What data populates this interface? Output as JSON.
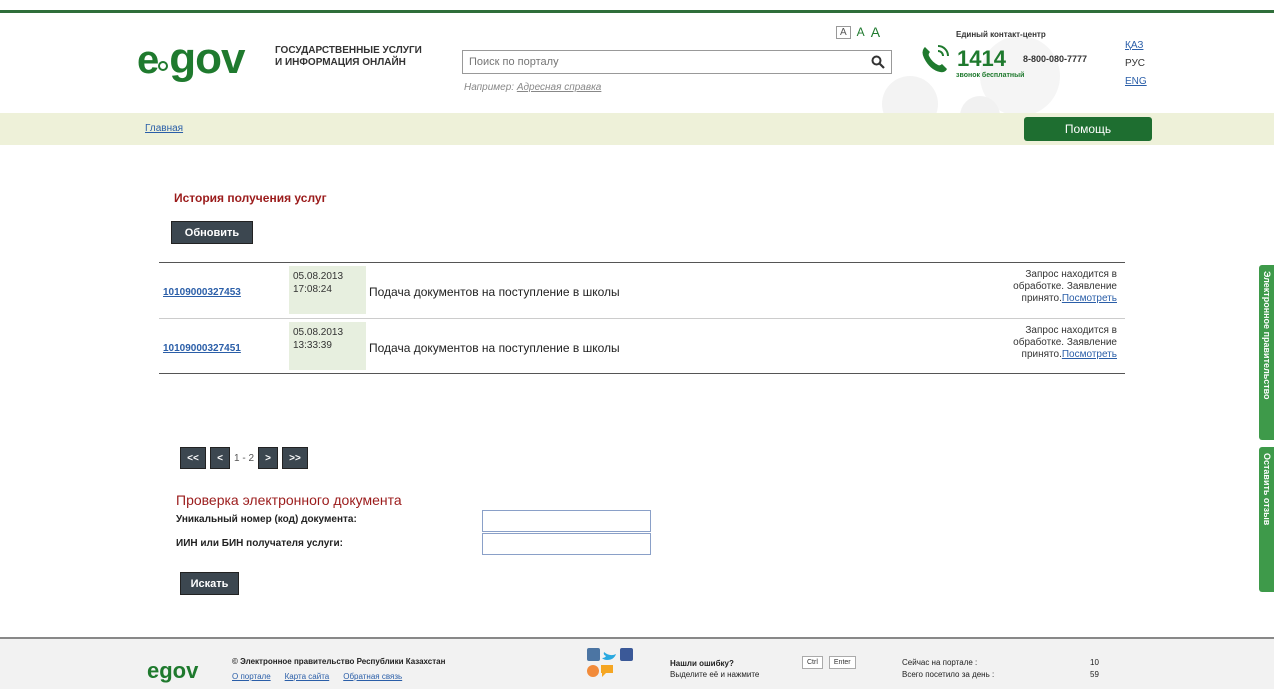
{
  "header": {
    "logo_text": "egov",
    "tagline_line1": "Государственные услуги",
    "tagline_line2": "и информация онлайн",
    "search_placeholder": "Поиск по порталу",
    "search_example_prefix": "Например:",
    "search_example_link": "Адресная справка",
    "font_size_labels": [
      "A",
      "A",
      "A"
    ],
    "contact_label": "Единый контакт-центр",
    "phone_main": "1414",
    "phone_alt": "8-800-080-7777",
    "phone_free": "звонок бесплатный",
    "languages": [
      {
        "label": "ҚАЗ",
        "active": false
      },
      {
        "label": "РУС",
        "active": true
      },
      {
        "label": "ENG",
        "active": false
      }
    ]
  },
  "navbar": {
    "breadcrumb": "Главная",
    "help_label": "Помощь"
  },
  "main": {
    "title": "История получения услуг",
    "refresh_label": "Обновить",
    "history": [
      {
        "id": "10109000327453",
        "date": "05.08.2013",
        "time": "17:08:24",
        "service": "Подача документов на поступление в школы",
        "status": "Запрос находится в обработке. Заявление принято.",
        "view_label": "Посмотреть"
      },
      {
        "id": "10109000327451",
        "date": "05.08.2013",
        "time": "13:33:39",
        "service": "Подача документов на поступление в школы",
        "status": "Запрос находится в обработке. Заявление принято.",
        "view_label": "Посмотреть"
      }
    ],
    "pager": {
      "first": "<<",
      "prev": "<",
      "pages_text": "1 - 2",
      "next": ">",
      "last": ">>"
    },
    "verify": {
      "title": "Проверка электронного документа",
      "doc_number_label": "Уникальный номер (код) документа:",
      "iin_label": "ИИН или БИН получателя услуги:",
      "doc_number_value": "",
      "iin_value": "",
      "search_label": "Искать"
    }
  },
  "side_tabs": [
    "Электронное правительство",
    "Оставить отзыв"
  ],
  "footer": {
    "logo_text": "egov",
    "copyright": "© Электронное правительство Республики Казахстан",
    "links": [
      "О портале",
      "Карта сайта",
      "Обратная связь"
    ],
    "error_title": "Нашли ошибку?",
    "error_sub": "Выделите её и нажмите",
    "keys": [
      "Ctrl",
      "Enter"
    ],
    "stat_online_label": "Сейчас на портале :",
    "stat_today_label": "Всего посетило за день :",
    "stat_online_value": "10",
    "stat_today_value": "59"
  },
  "colors": {
    "brand_green": "#1f7a2e",
    "button_dark": "#3c4750",
    "title_red": "#9b1b1b",
    "nav_bg": "#eef1d9",
    "link_blue": "#2a5ea8"
  }
}
